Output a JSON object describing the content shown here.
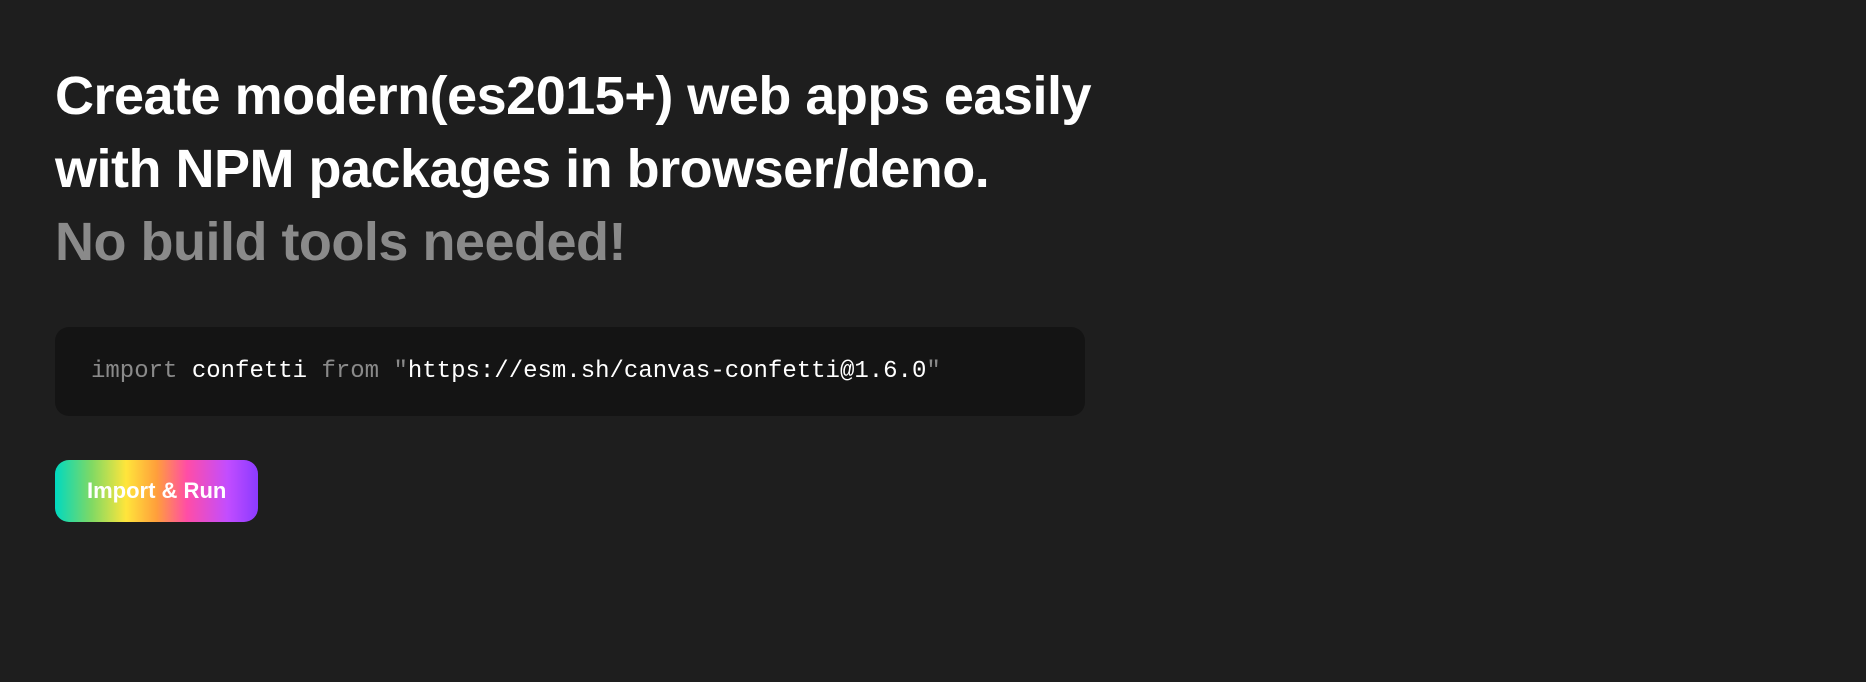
{
  "heading": {
    "line1": "Create modern(es2015+) web apps easily",
    "line2": "with NPM packages in browser/deno.",
    "line3": "No build tools needed!"
  },
  "code": {
    "keyword_import": "import",
    "identifier": "confetti",
    "keyword_from": "from",
    "quote_open": "\"",
    "url": "https://esm.sh/canvas-confetti@1.6.0",
    "quote_close": "\""
  },
  "button": {
    "label": "Import & Run"
  }
}
